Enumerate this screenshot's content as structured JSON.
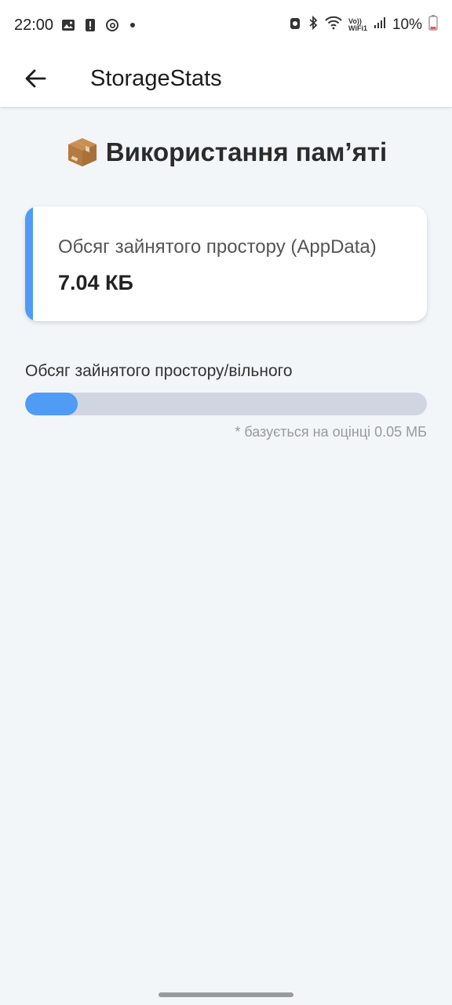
{
  "status_bar": {
    "time": "22:00",
    "battery_percent": "10%",
    "vowifi_top": "Vo))",
    "vowifi_bottom": "WiFi1",
    "icons": [
      "gallery-icon",
      "alert-icon",
      "threads-icon",
      "notification-dot",
      "alarm-icon",
      "bluetooth-icon",
      "wifi-icon",
      "vowifi-icon",
      "signal-icon",
      "battery-icon"
    ]
  },
  "app_bar": {
    "title": "StorageStats",
    "back_icon": "arrow-left-icon"
  },
  "page": {
    "title": "Використання пам’яті",
    "title_icon": "package-icon"
  },
  "card": {
    "label": "Обсяг зайнятого простору (AppData)",
    "value": "7.04 КБ",
    "accent_color": "#4f9bf6"
  },
  "usage": {
    "label": "Обсяг зайнятого простору/вільного",
    "progress_fraction": 0.13,
    "footnote": "* базується на оцінці 0.05 МБ",
    "track_color": "#d0d6e1",
    "fill_color": "#4f9bf6"
  }
}
